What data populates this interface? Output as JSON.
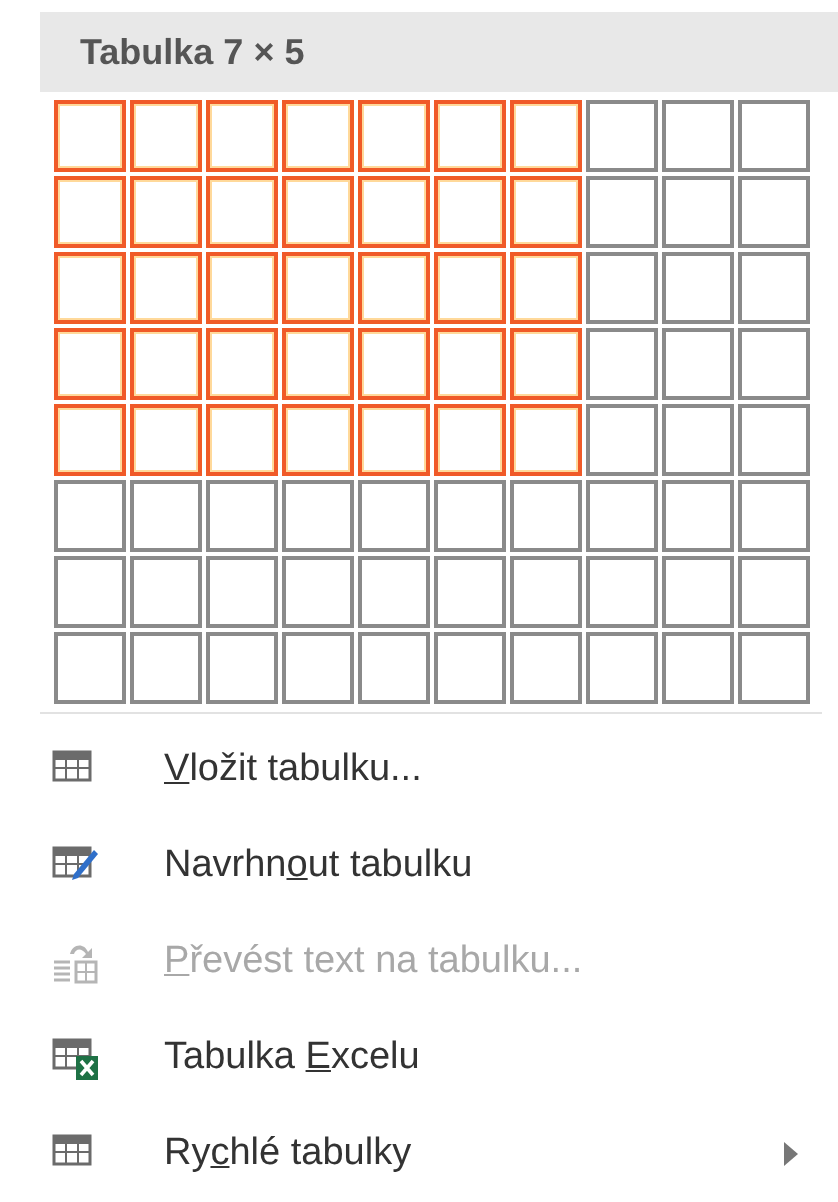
{
  "header": {
    "title": "Tabulka 7 × 5"
  },
  "grid": {
    "rows": [
      {
        "cells": [
          {
            "selected": true
          },
          {
            "selected": true
          },
          {
            "selected": true
          },
          {
            "selected": true
          },
          {
            "selected": true
          },
          {
            "selected": true
          },
          {
            "selected": true
          },
          {
            "selected": false
          },
          {
            "selected": false
          },
          {
            "selected": false
          }
        ]
      },
      {
        "cells": [
          {
            "selected": true
          },
          {
            "selected": true
          },
          {
            "selected": true
          },
          {
            "selected": true
          },
          {
            "selected": true
          },
          {
            "selected": true
          },
          {
            "selected": true
          },
          {
            "selected": false
          },
          {
            "selected": false
          },
          {
            "selected": false
          }
        ]
      },
      {
        "cells": [
          {
            "selected": true
          },
          {
            "selected": true
          },
          {
            "selected": true
          },
          {
            "selected": true
          },
          {
            "selected": true
          },
          {
            "selected": true
          },
          {
            "selected": true
          },
          {
            "selected": false
          },
          {
            "selected": false
          },
          {
            "selected": false
          }
        ]
      },
      {
        "cells": [
          {
            "selected": true
          },
          {
            "selected": true
          },
          {
            "selected": true
          },
          {
            "selected": true
          },
          {
            "selected": true
          },
          {
            "selected": true
          },
          {
            "selected": true
          },
          {
            "selected": false
          },
          {
            "selected": false
          },
          {
            "selected": false
          }
        ]
      },
      {
        "cells": [
          {
            "selected": true
          },
          {
            "selected": true
          },
          {
            "selected": true
          },
          {
            "selected": true
          },
          {
            "selected": true
          },
          {
            "selected": true
          },
          {
            "selected": true
          },
          {
            "selected": false
          },
          {
            "selected": false
          },
          {
            "selected": false
          }
        ]
      },
      {
        "cells": [
          {
            "selected": false
          },
          {
            "selected": false
          },
          {
            "selected": false
          },
          {
            "selected": false
          },
          {
            "selected": false
          },
          {
            "selected": false
          },
          {
            "selected": false
          },
          {
            "selected": false
          },
          {
            "selected": false
          },
          {
            "selected": false
          }
        ]
      },
      {
        "cells": [
          {
            "selected": false
          },
          {
            "selected": false
          },
          {
            "selected": false
          },
          {
            "selected": false
          },
          {
            "selected": false
          },
          {
            "selected": false
          },
          {
            "selected": false
          },
          {
            "selected": false
          },
          {
            "selected": false
          },
          {
            "selected": false
          }
        ]
      },
      {
        "cells": [
          {
            "selected": false
          },
          {
            "selected": false
          },
          {
            "selected": false
          },
          {
            "selected": false
          },
          {
            "selected": false
          },
          {
            "selected": false
          },
          {
            "selected": false
          },
          {
            "selected": false
          },
          {
            "selected": false
          },
          {
            "selected": false
          }
        ]
      }
    ]
  },
  "menu": [
    {
      "kind": "insert",
      "key": "V",
      "after": "ložit tabulku...",
      "disabled": false,
      "submenu": false
    },
    {
      "kind": "draw",
      "before": "Navrhn",
      "key": "o",
      "after": "ut tabulku",
      "disabled": false,
      "submenu": false
    },
    {
      "kind": "convert",
      "key": "P",
      "after": "řevést text na tabulku...",
      "disabled": true,
      "submenu": false
    },
    {
      "kind": "excel",
      "before": "Tabulka ",
      "key": "E",
      "after": "xcelu",
      "disabled": false,
      "submenu": false
    },
    {
      "kind": "quick",
      "before": "Ry",
      "key": "c",
      "after": "hlé tabulky",
      "disabled": false,
      "submenu": true
    }
  ]
}
